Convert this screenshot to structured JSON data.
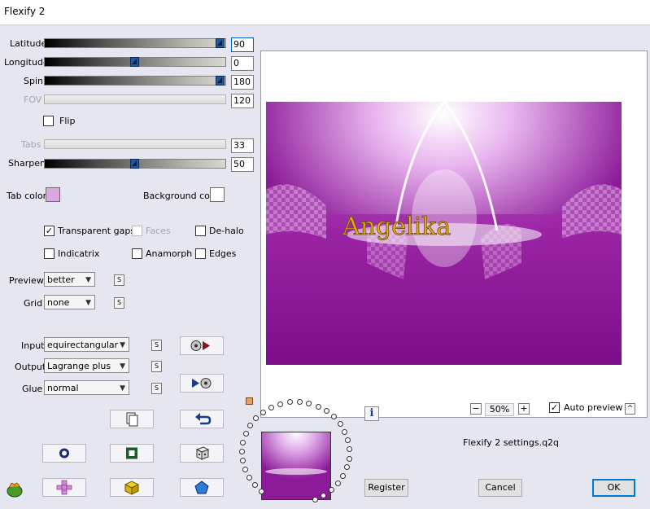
{
  "window": {
    "title": "Flexify 2"
  },
  "sliders": [
    {
      "label": "Latitude",
      "value": "90",
      "position": 1.0,
      "enabled": true
    },
    {
      "label": "Longitude",
      "value": "0",
      "position": 0.5,
      "enabled": true
    },
    {
      "label": "Spin",
      "value": "180",
      "position": 1.0,
      "enabled": true
    },
    {
      "label": "FOV",
      "value": "120",
      "enabled": false
    },
    {
      "label": "Tabs",
      "value": "33",
      "enabled": false
    },
    {
      "label": "Sharpen",
      "value": "50",
      "position": 0.5,
      "enabled": true
    }
  ],
  "flip": {
    "label": "Flip",
    "checked": false
  },
  "tab_color": {
    "label": "Tab color",
    "color": "#d8a8e0"
  },
  "background_color": {
    "label": "Background color",
    "color": "#ffffff"
  },
  "options": {
    "transparent_gaps": {
      "label": "Transparent gaps",
      "checked": true
    },
    "faces": {
      "label": "Faces",
      "checked": false
    },
    "de_halo": {
      "label": "De-halo",
      "checked": false
    },
    "indicatrix": {
      "label": "Indicatrix",
      "checked": false
    },
    "anamorph": {
      "label": "Anamorph",
      "checked": false
    },
    "edges": {
      "label": "Edges",
      "checked": false
    }
  },
  "preview_quality": {
    "label": "Preview",
    "value": "better"
  },
  "grid": {
    "label": "Grid",
    "value": "none"
  },
  "input": {
    "label": "Input",
    "value": "equirectangular"
  },
  "output": {
    "label": "Output",
    "value": "Lagrange plus"
  },
  "glue": {
    "label": "Glue",
    "value": "normal"
  },
  "s_label": "S",
  "watermark": "Angelika",
  "zoom": {
    "minus": "−",
    "value": "50%",
    "plus": "+"
  },
  "auto_preview": {
    "label": "Auto preview",
    "checked": true
  },
  "settings_file": "Flexify 2 settings.q2q",
  "buttons": {
    "register": "Register",
    "cancel": "Cancel",
    "ok": "OK",
    "info": "i",
    "collapse": "^"
  },
  "colors": {
    "accent": "#0078d7",
    "magenta": "#8c1a99",
    "panel": "#e6e6f0"
  }
}
